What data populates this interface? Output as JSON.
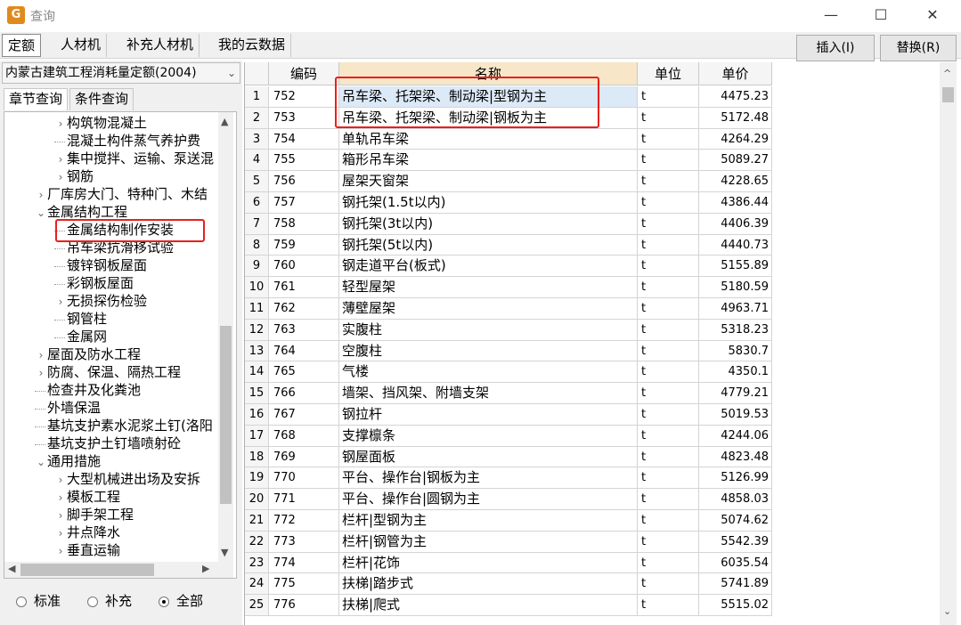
{
  "window": {
    "title": "查询",
    "icon": "app-logo-icon",
    "minimize": "—",
    "maximize": "☐",
    "close": "✕"
  },
  "tabs": [
    {
      "label": "定额",
      "active": true
    },
    {
      "label": "人材机",
      "active": false
    },
    {
      "label": "补充人材机",
      "active": false
    },
    {
      "label": "我的云数据",
      "active": false
    }
  ],
  "toolbar": {
    "insert_label": "插入(I)",
    "replace_label": "替换(R)"
  },
  "left_panel": {
    "quota_library": "内蒙古建筑工程消耗量定额(2004)",
    "subtabs": [
      {
        "label": "章节查询",
        "active": true
      },
      {
        "label": "条件查询",
        "active": false
      }
    ],
    "tree": [
      {
        "label": "构筑物混凝土",
        "indent": 3,
        "toggle": "expand"
      },
      {
        "label": "混凝土构件蒸气养护费",
        "indent": 3,
        "toggle": "leaf"
      },
      {
        "label": "集中搅拌、运输、泵送混",
        "indent": 3,
        "toggle": "expand"
      },
      {
        "label": "钢筋",
        "indent": 3,
        "toggle": "expand"
      },
      {
        "label": "厂库房大门、特种门、木结",
        "indent": 2,
        "toggle": "expand"
      },
      {
        "label": "金属结构工程",
        "indent": 2,
        "toggle": "collapse"
      },
      {
        "label": "金属结构制作安装",
        "indent": 3,
        "toggle": "leaf",
        "selected": true
      },
      {
        "label": "吊车梁抗滑移试验",
        "indent": 3,
        "toggle": "leaf"
      },
      {
        "label": "镀锌钢板屋面",
        "indent": 3,
        "toggle": "leaf"
      },
      {
        "label": "彩钢板屋面",
        "indent": 3,
        "toggle": "leaf"
      },
      {
        "label": "无损探伤检验",
        "indent": 3,
        "toggle": "expand"
      },
      {
        "label": "钢管柱",
        "indent": 3,
        "toggle": "leaf"
      },
      {
        "label": "金属网",
        "indent": 3,
        "toggle": "leaf"
      },
      {
        "label": "屋面及防水工程",
        "indent": 2,
        "toggle": "expand"
      },
      {
        "label": "防腐、保温、隔热工程",
        "indent": 2,
        "toggle": "expand"
      },
      {
        "label": "检查井及化粪池",
        "indent": 2,
        "toggle": "leaf"
      },
      {
        "label": "外墙保温",
        "indent": 2,
        "toggle": "leaf"
      },
      {
        "label": "基坑支护素水泥浆土钉(洛阳",
        "indent": 2,
        "toggle": "leaf"
      },
      {
        "label": "基坑支护土钉墙喷射砼",
        "indent": 2,
        "toggle": "leaf"
      },
      {
        "label": "通用措施",
        "indent": 2,
        "toggle": "collapse"
      },
      {
        "label": "大型机械进出场及安拆",
        "indent": 3,
        "toggle": "expand"
      },
      {
        "label": "模板工程",
        "indent": 3,
        "toggle": "expand"
      },
      {
        "label": "脚手架工程",
        "indent": 3,
        "toggle": "expand"
      },
      {
        "label": "井点降水",
        "indent": 3,
        "toggle": "expand"
      },
      {
        "label": "垂直运输",
        "indent": 3,
        "toggle": "expand"
      }
    ],
    "filter_options": [
      {
        "label": "标准",
        "checked": false
      },
      {
        "label": "补充",
        "checked": false
      },
      {
        "label": "全部",
        "checked": true
      }
    ]
  },
  "grid": {
    "columns": [
      "编码",
      "名称",
      "单位",
      "单价"
    ],
    "rows": [
      {
        "num": "1",
        "code": "752",
        "name": "吊车梁、托架梁、制动梁|型钢为主",
        "unit": "t",
        "price": "4475.23",
        "selected": true
      },
      {
        "num": "2",
        "code": "753",
        "name": "吊车梁、托架梁、制动梁|钢板为主",
        "unit": "t",
        "price": "5172.48"
      },
      {
        "num": "3",
        "code": "754",
        "name": "单轨吊车梁",
        "unit": "t",
        "price": "4264.29"
      },
      {
        "num": "4",
        "code": "755",
        "name": "箱形吊车梁",
        "unit": "t",
        "price": "5089.27"
      },
      {
        "num": "5",
        "code": "756",
        "name": "屋架天窗架",
        "unit": "t",
        "price": "4228.65"
      },
      {
        "num": "6",
        "code": "757",
        "name": "钢托架(1.5t以内)",
        "unit": "t",
        "price": "4386.44"
      },
      {
        "num": "7",
        "code": "758",
        "name": "钢托架(3t以内)",
        "unit": "t",
        "price": "4406.39"
      },
      {
        "num": "8",
        "code": "759",
        "name": "钢托架(5t以内)",
        "unit": "t",
        "price": "4440.73"
      },
      {
        "num": "9",
        "code": "760",
        "name": "钢走道平台(板式)",
        "unit": "t",
        "price": "5155.89"
      },
      {
        "num": "10",
        "code": "761",
        "name": "轻型屋架",
        "unit": "t",
        "price": "5180.59"
      },
      {
        "num": "11",
        "code": "762",
        "name": "薄壁屋架",
        "unit": "t",
        "price": "4963.71"
      },
      {
        "num": "12",
        "code": "763",
        "name": "实腹柱",
        "unit": "t",
        "price": "5318.23"
      },
      {
        "num": "13",
        "code": "764",
        "name": "空腹柱",
        "unit": "t",
        "price": "5830.7"
      },
      {
        "num": "14",
        "code": "765",
        "name": "气楼",
        "unit": "t",
        "price": "4350.1"
      },
      {
        "num": "15",
        "code": "766",
        "name": "墙架、挡风架、附墙支架",
        "unit": "t",
        "price": "4779.21"
      },
      {
        "num": "16",
        "code": "767",
        "name": "钢拉杆",
        "unit": "t",
        "price": "5019.53"
      },
      {
        "num": "17",
        "code": "768",
        "name": "支撑檩条",
        "unit": "t",
        "price": "4244.06"
      },
      {
        "num": "18",
        "code": "769",
        "name": "钢屋面板",
        "unit": "t",
        "price": "4823.48"
      },
      {
        "num": "19",
        "code": "770",
        "name": "平台、操作台|钢板为主",
        "unit": "t",
        "price": "5126.99"
      },
      {
        "num": "20",
        "code": "771",
        "name": "平台、操作台|圆钢为主",
        "unit": "t",
        "price": "4858.03"
      },
      {
        "num": "21",
        "code": "772",
        "name": "栏杆|型钢为主",
        "unit": "t",
        "price": "5074.62"
      },
      {
        "num": "22",
        "code": "773",
        "name": "栏杆|钢管为主",
        "unit": "t",
        "price": "5542.39"
      },
      {
        "num": "23",
        "code": "774",
        "name": "栏杆|花饰",
        "unit": "t",
        "price": "6035.54"
      },
      {
        "num": "24",
        "code": "775",
        "name": "扶梯|踏步式",
        "unit": "t",
        "price": "5741.89"
      },
      {
        "num": "25",
        "code": "776",
        "name": "扶梯|爬式",
        "unit": "t",
        "price": "5515.02"
      }
    ]
  },
  "colors": {
    "highlight_border": "#e8201b",
    "selected_header": "#f7e6c8",
    "selected_row": "#dce9f7"
  }
}
